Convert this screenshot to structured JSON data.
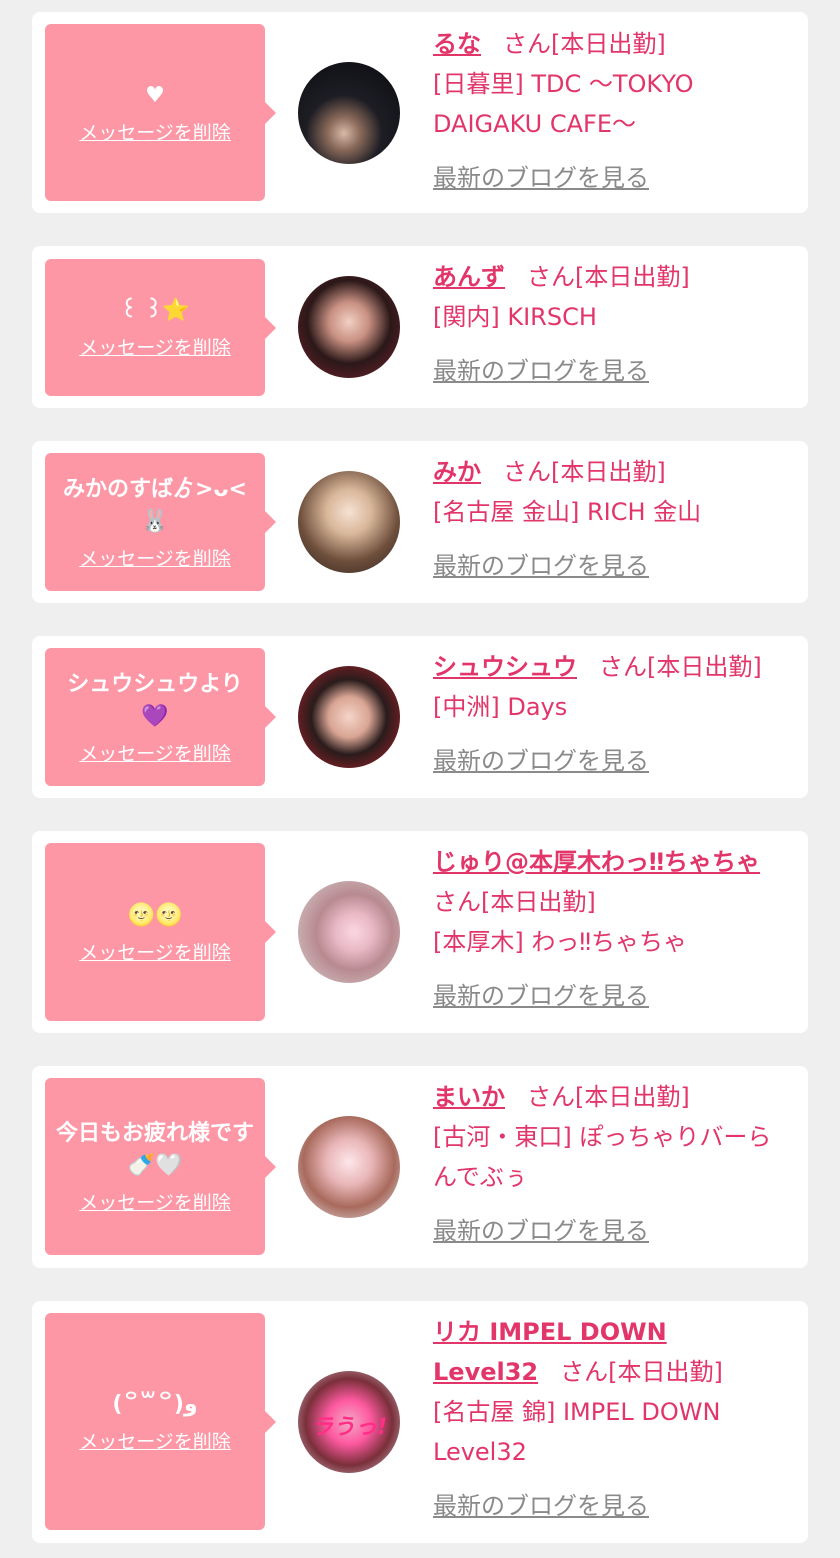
{
  "delete_label": "メッセージを削除",
  "blog_label": "最新のブログを見る",
  "status_label": "さん[本日出勤]",
  "cards": [
    {
      "message": "♥",
      "name": "るな",
      "shop": "[日暮里] TDC 〜TOKYO DAIGAKU CAFE〜"
    },
    {
      "message": "꒰ ꒱⭐",
      "name": "あんず",
      "shop": "[関内] KIRSCH"
    },
    {
      "message": "みかのすばゟ>ᴗ<🐰",
      "name": "みか",
      "shop": "[名古屋 金山] RICH 金山"
    },
    {
      "message": "シュウシュウより💜",
      "name": "シュウシュウ",
      "shop": "[中洲] Days"
    },
    {
      "message": "🌝🌝",
      "name": "じゅり@本厚木わっ‼ちゃちゃ",
      "shop": "[本厚木] わっ‼ちゃちゃ"
    },
    {
      "message": "今日もお疲れ様です🍼🤍",
      "name": "まいか",
      "shop": "[古河・東口] ぽっちゃりバーらんでぶぅ"
    },
    {
      "message": "(꒪꒳꒪)و",
      "name": "リカ IMPEL DOWN Level32",
      "shop": "[名古屋 錦] IMPEL DOWN Level32",
      "avatar_text": "ラうっ!"
    }
  ],
  "colors": {
    "page_bg": "#efefef",
    "card_bg": "#ffffff",
    "message_bg": "#fd97a6",
    "accent": "#e2356a",
    "link_gray": "#8a8a8a"
  }
}
